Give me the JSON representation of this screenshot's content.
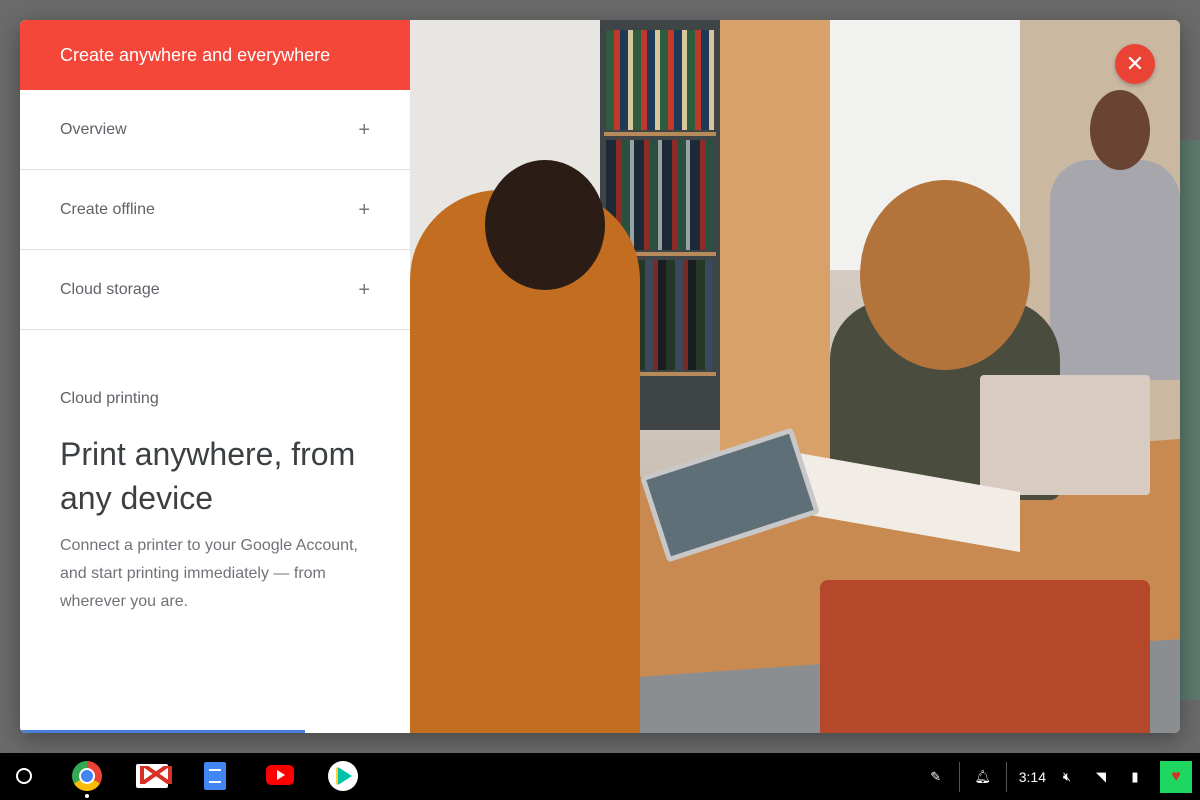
{
  "dialog": {
    "header_title": "Create anywhere and everywhere",
    "close_icon": "close-icon",
    "accordion": [
      {
        "label": "Overview",
        "expand_glyph": "+"
      },
      {
        "label": "Create offline",
        "expand_glyph": "+"
      },
      {
        "label": "Cloud storage",
        "expand_glyph": "+"
      }
    ],
    "open_section": {
      "label": "Cloud printing",
      "heading": "Print anywhere, from any device",
      "body": "Connect a printer to your Google Account, and start printing immediately — from wherever you are."
    },
    "accent_color": "#f4473a",
    "progress_color": "#4a7fd8"
  },
  "shelf": {
    "apps": [
      "chrome-icon",
      "gmail-icon",
      "docs-icon",
      "youtube-icon",
      "play-store-icon"
    ],
    "time": "3:14",
    "tray_icons": [
      "stylus-icon",
      "notification-icon",
      "mute-icon",
      "wifi-icon",
      "battery-icon",
      "avatar"
    ]
  }
}
